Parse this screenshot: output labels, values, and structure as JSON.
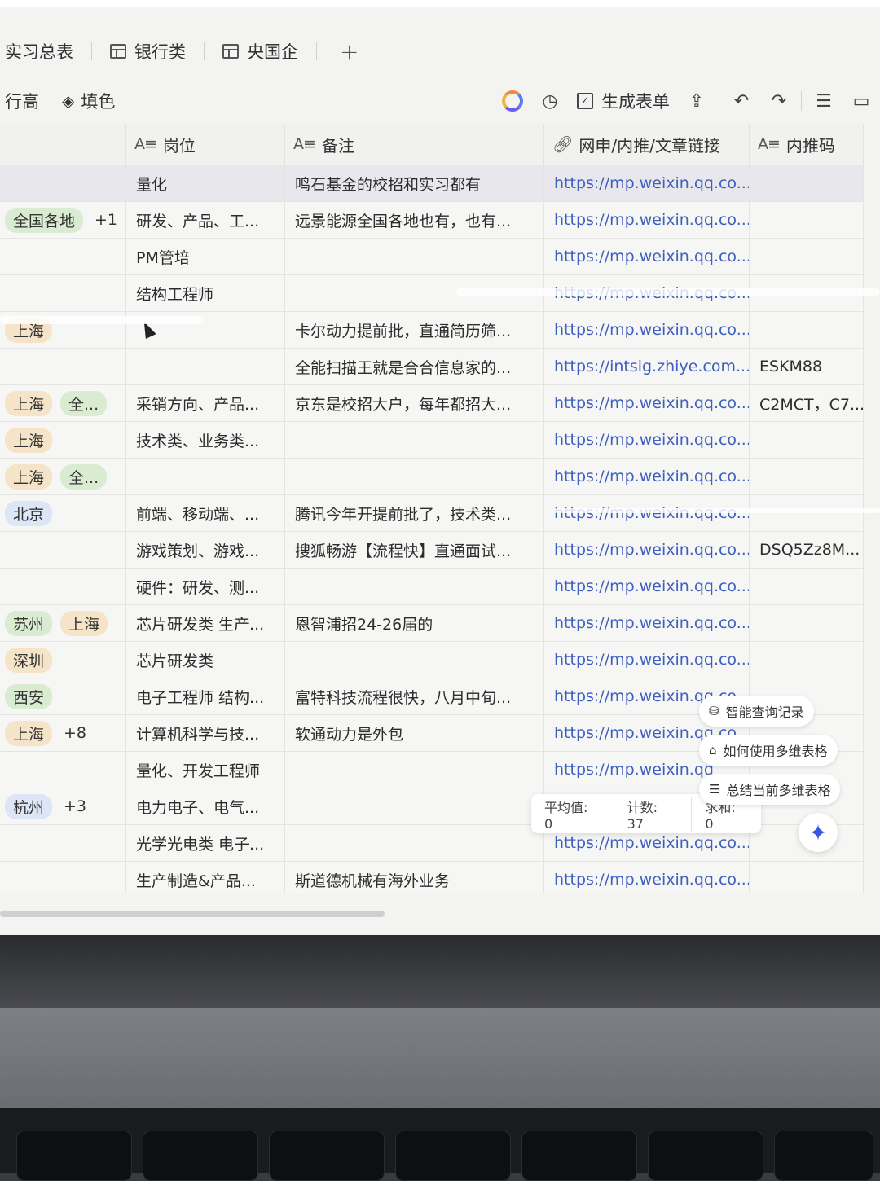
{
  "tabs": [
    {
      "label": "实习总表",
      "icon": ""
    },
    {
      "label": "银行类",
      "icon": "grid-table-icon"
    },
    {
      "label": "央国企",
      "icon": "grid-table-icon"
    }
  ],
  "tab_add": "+",
  "toolbar": {
    "row_height": "行高",
    "fill_color": "填色",
    "generate_form": "生成表单"
  },
  "columns": [
    {
      "type": "A≡",
      "label": "岗位"
    },
    {
      "type": "A≡",
      "label": "备注"
    },
    {
      "type": "link",
      "label": "网申/内推/文章链接"
    },
    {
      "type": "A≡",
      "label": "内推码"
    }
  ],
  "rows": [
    {
      "loc": [],
      "pos": "量化",
      "note": "鸣石基金的校招和实习都有",
      "link": "https://mp.weixin.qq.co...",
      "code": ""
    },
    {
      "loc": [
        {
          "t": "全国各地",
          "c": "g"
        },
        {
          "t": "+1",
          "c": "plain"
        }
      ],
      "pos": "研发、产品、工...",
      "note": "远景能源全国各地也有，也有...",
      "link": "https://mp.weixin.qq.co...",
      "code": ""
    },
    {
      "loc": [],
      "pos": "PM管培",
      "note": "",
      "link": "https://mp.weixin.qq.co...",
      "code": ""
    },
    {
      "loc": [],
      "pos": "结构工程师",
      "note": "",
      "link": "https://mp.weixin.qq.co...",
      "code": ""
    },
    {
      "loc": [
        {
          "t": "上海",
          "c": "o"
        }
      ],
      "pos": "",
      "note": "卡尔动力提前批，直通简历筛...",
      "link": "https://mp.weixin.qq.co...",
      "code": ""
    },
    {
      "loc": [],
      "pos": "",
      "note": "全能扫描王就是合合信息家的...",
      "link": "https://intsig.zhiye.com...",
      "code": "ESKM88"
    },
    {
      "loc": [
        {
          "t": "上海",
          "c": "o"
        },
        {
          "t": "全...",
          "c": "g"
        }
      ],
      "pos": "采销方向、产品...",
      "note": "京东是校招大户，每年都招大...",
      "link": "https://mp.weixin.qq.co...",
      "code": "C2MCT，C7..."
    },
    {
      "loc": [
        {
          "t": "上海",
          "c": "o"
        }
      ],
      "pos": "技术类、业务类...",
      "note": "",
      "link": "https://mp.weixin.qq.co...",
      "code": ""
    },
    {
      "loc": [
        {
          "t": "上海",
          "c": "o"
        },
        {
          "t": "全...",
          "c": "g"
        }
      ],
      "pos": "",
      "note": "",
      "link": "https://mp.weixin.qq.co...",
      "code": ""
    },
    {
      "loc": [
        {
          "t": "北京",
          "c": "b"
        }
      ],
      "pos": "前端、移动端、...",
      "note": "腾讯今年开提前批了，技术类...",
      "link": "https://mp.weixin.qq.co...",
      "code": ""
    },
    {
      "loc": [],
      "pos": "游戏策划、游戏...",
      "note": "搜狐畅游【流程快】直通面试...",
      "link": "https://mp.weixin.qq.co...",
      "code": "DSQ5Zz8M..."
    },
    {
      "loc": [],
      "pos": "硬件：研发、测...",
      "note": "",
      "link": "https://mp.weixin.qq.co...",
      "code": ""
    },
    {
      "loc": [
        {
          "t": "苏州",
          "c": "g"
        },
        {
          "t": "上海",
          "c": "o"
        }
      ],
      "pos": "芯片研发类 生产...",
      "note": "恩智浦招24-26届的",
      "link": "https://mp.weixin.qq.co...",
      "code": ""
    },
    {
      "loc": [
        {
          "t": "深圳",
          "c": "o"
        }
      ],
      "pos": "芯片研发类",
      "note": "",
      "link": "https://mp.weixin.qq.co...",
      "code": ""
    },
    {
      "loc": [
        {
          "t": "西安",
          "c": "g"
        }
      ],
      "pos": "电子工程师 结构...",
      "note": "富特科技流程很快，八月中旬...",
      "link": "https://mp.weixin.qq.co...",
      "code": ""
    },
    {
      "loc": [
        {
          "t": "上海",
          "c": "o"
        },
        {
          "t": "+8",
          "c": "plain"
        }
      ],
      "pos": "计算机科学与技...",
      "note": "软通动力是外包",
      "link": "https://mp.weixin.qq.co...",
      "code": ""
    },
    {
      "loc": [],
      "pos": "量化、开发工程师",
      "note": "",
      "link": "https://mp.weixin.qq",
      "code": ""
    },
    {
      "loc": [
        {
          "t": "杭州",
          "c": "b"
        },
        {
          "t": "+3",
          "c": "plain"
        }
      ],
      "pos": "电力电子、电气...",
      "note": "",
      "link": "",
      "code": ""
    },
    {
      "loc": [],
      "pos": "光学光电类 电子...",
      "note": "",
      "link": "https://mp.weixin.qq.co...",
      "code": ""
    },
    {
      "loc": [],
      "pos": "生产制造&产品...",
      "note": "斯道德机械有海外业务",
      "link": "https://mp.weixin.qq.co...",
      "code": ""
    }
  ],
  "stats": {
    "avg": "平均值: 0",
    "count": "计数: 37",
    "sum": "求和: 0"
  },
  "helpers": [
    {
      "label": "智能查询记录",
      "icon": "database-icon"
    },
    {
      "label": "如何使用多维表格",
      "icon": "graduation-cap-icon"
    },
    {
      "label": "总结当前多维表格",
      "icon": "list-icon"
    }
  ],
  "ai_button_icon": "sparkle-icon"
}
